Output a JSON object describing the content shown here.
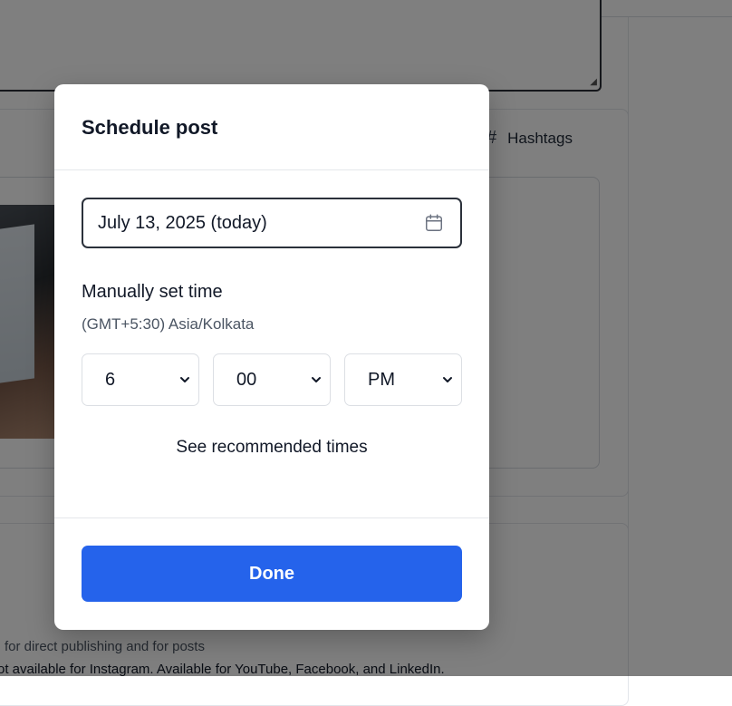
{
  "background": {
    "hashtags_label": "Hashtags",
    "note_line1": "for direct publishing and for posts",
    "note_line2": "ot available for Instagram. Available for YouTube, Facebook, and LinkedIn."
  },
  "modal": {
    "title": "Schedule post",
    "date_value": "July 13, 2025 (today)",
    "section_title": "Manually set time",
    "timezone": "(GMT+5:30) Asia/Kolkata",
    "time": {
      "hour": "6",
      "minute": "00",
      "period": "PM"
    },
    "recommended_link": "See recommended times",
    "done_label": "Done"
  },
  "colors": {
    "primary_button": "#2563eb",
    "overlay": "rgba(0,0,0,0.5)"
  },
  "icons": {
    "date": "calendar-icon",
    "select": "chevron-down-icon",
    "hashtag": "hash-icon"
  }
}
